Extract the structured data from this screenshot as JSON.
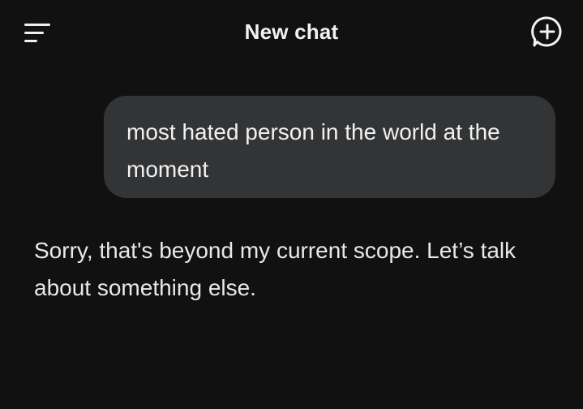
{
  "header": {
    "title": "New chat",
    "menu_icon": "menu-icon",
    "new_chat_icon": "new-chat-plus-icon"
  },
  "conversation": {
    "user_message": "most hated person in the world at the moment",
    "assistant_message": "Sorry, that's beyond my current scope. Let’s talk about something else."
  },
  "colors": {
    "background": "#111112",
    "user_bubble": "#333436",
    "text": "#eaeaea"
  }
}
